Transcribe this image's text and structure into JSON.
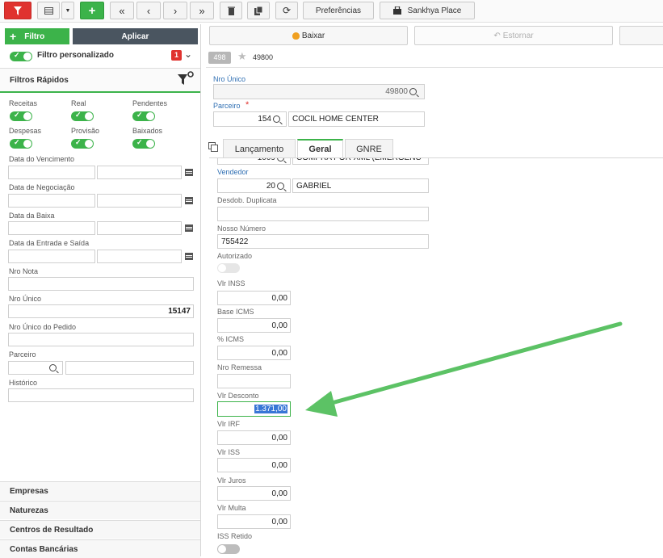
{
  "toolbar": {
    "preferencias": "Preferências",
    "sankhya_place": "Sankhya Place"
  },
  "left": {
    "filtro_button": "Filtro",
    "aplicar_button": "Aplicar",
    "filtro_personalizado": "Filtro personalizado",
    "filtro_badge": "1",
    "filtros_rapidos": "Filtros Rápidos",
    "toggles": [
      {
        "label": "Receitas",
        "on": true
      },
      {
        "label": "Real",
        "on": true
      },
      {
        "label": "Pendentes",
        "on": true
      },
      {
        "label": "Despesas",
        "on": true
      },
      {
        "label": "Provisão",
        "on": true
      },
      {
        "label": "Baixados",
        "on": true
      }
    ],
    "data_vencimento": "Data do Vencimento",
    "data_negociacao": "Data de Negociação",
    "data_baixa": "Data da Baixa",
    "data_entrada_saida": "Data da Entrada e Saída",
    "nro_nota": "Nro Nota",
    "nro_unico": "Nro Único",
    "nro_unico_value": "15147",
    "nro_unico_pedido": "Nro Único do Pedido",
    "parceiro": "Parceiro",
    "historico": "Histórico",
    "accordions": [
      "Empresas",
      "Naturezas",
      "Centros de Resultado",
      "Contas Bancárias"
    ]
  },
  "right": {
    "baixar": "Baixar",
    "estornar": "Estornar",
    "record_count": "498",
    "record_id": "49800",
    "nro_unico_label": "Nro Único",
    "nro_unico_value": "49800",
    "parceiro_label": "Parceiro",
    "parceiro_code": "154",
    "parceiro_name": "COCIL HOME CENTER",
    "tabs": [
      "Lançamento",
      "Geral",
      "GNRE"
    ],
    "active_tab": "Geral",
    "top_type_code": "1009",
    "top_type_name": "COMPRA POR XML (EMERGENC",
    "vendedor_label": "Vendedor",
    "vendedor_code": "20",
    "vendedor_name": "GABRIEL",
    "desdob_label": "Desdob. Duplicata",
    "nosso_numero_label": "Nosso Número",
    "nosso_numero_value": "755422",
    "autorizado_label": "Autorizado",
    "fields": [
      {
        "label": "Vlr INSS",
        "value": "0,00"
      },
      {
        "label": "Base ICMS",
        "value": "0,00"
      },
      {
        "label": "% ICMS",
        "value": "0,00"
      },
      {
        "label": "Nro Remessa",
        "value": ""
      },
      {
        "label": "Vlr Desconto",
        "value": "1.371,00"
      },
      {
        "label": "Vlr IRF",
        "value": "0,00"
      },
      {
        "label": "Vlr ISS",
        "value": "0,00"
      },
      {
        "label": "Vlr Juros",
        "value": "0,00"
      },
      {
        "label": "Vlr Multa",
        "value": "0,00"
      }
    ],
    "iss_retido_label": "ISS Retido"
  },
  "colors": {
    "accent_green": "#3cb34a",
    "arrow_green": "#5cc265",
    "red": "#e0322f",
    "dark": "#4a5560"
  }
}
